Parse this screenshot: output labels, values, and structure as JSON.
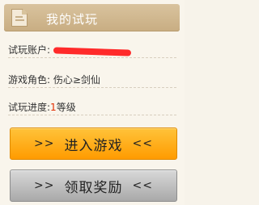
{
  "header": {
    "title": "我的试玩"
  },
  "rows": {
    "account_label": "试玩账户:",
    "role_label": "游戏角色:",
    "role_value": "伤心≥剑仙",
    "progress_label": "试玩进度:",
    "progress_level": "1",
    "progress_suffix": "等级"
  },
  "buttons": {
    "enter_label": "进入游戏",
    "claim_label": "领取奖励",
    "left_arrows": ">>",
    "right_arrows": "<<"
  },
  "colors": {
    "header_bg": "#c8ad82",
    "accent_orange": "#ff9b00",
    "level_red": "#e22d00",
    "redaction_red": "#ff2a2a"
  }
}
